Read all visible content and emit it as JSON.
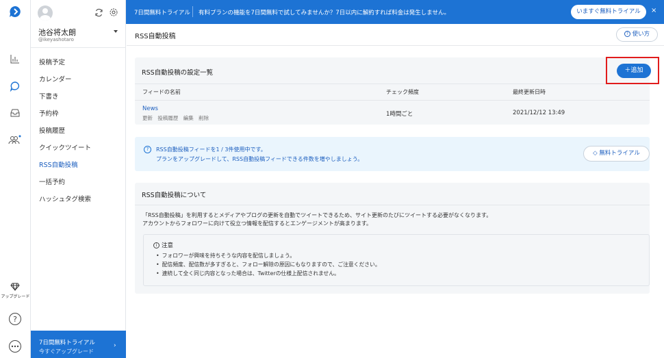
{
  "rail": {
    "upgrade_label": "アップグレード"
  },
  "sidebar": {
    "user_name": "池谷将太朗",
    "user_handle": "@ikeyashotaro",
    "items": [
      {
        "label": "投稿予定"
      },
      {
        "label": "カレンダー"
      },
      {
        "label": "下書き"
      },
      {
        "label": "予約枠"
      },
      {
        "label": "投稿履歴"
      },
      {
        "label": "クイックツイート"
      },
      {
        "label": "RSS自動投稿"
      },
      {
        "label": "一括予約"
      },
      {
        "label": "ハッシュタグ検索"
      }
    ],
    "active_index": 6,
    "trial_title": "7日間無料トライアル",
    "trial_sub": "今すぐアップグレード",
    "trial_arrow": "›"
  },
  "banner": {
    "title": "7日間無料トライアル",
    "text": "有料プランの機能を7日間無料で試してみませんか？7日以内に解約すれば料金は発生しません。",
    "button": "いますぐ無料トライアル",
    "close": "×"
  },
  "main": {
    "page_title": "RSS自動投稿",
    "help_label": "使い方",
    "settings_card": {
      "title": "RSS自動投稿の設定一覧",
      "add_label": "＋追加",
      "columns": [
        "フィードの名前",
        "チェック頻度",
        "最終更新日時"
      ],
      "rows": [
        {
          "name": "News",
          "actions": [
            "更新",
            "投稿履歴",
            "編集",
            "削除"
          ],
          "frequency": "1時間ごと",
          "updated": "2021/12/12 13:49"
        }
      ]
    },
    "info_card": {
      "line1": "RSS自動投稿フィードを1 / 3件使用中です。",
      "line2": "プランをアップグレードして、RSS自動投稿フィードできる件数を増やしましょう。",
      "trial_label": "無料トライアル"
    },
    "about_card": {
      "title": "RSS自動投稿について",
      "desc1": "「RSS自動投稿」を利用するとメディアやブログの更新を自動でツイートできるため、サイト更新のたびにツイートする必要がなくなります。",
      "desc2": "アカウントからフォロワーに向けて役立つ情報を配信するとエンゲージメントが高まります。",
      "note_title": "注意",
      "notes": [
        "フォロワーが興味を持ちそうな内容を配信しましょう。",
        "配信頻度、配信数が多すぎると、フォロー解除の原因にもなりますので、ご注意ください。",
        "連続して全く同じ内容となった場合は、Twitterの仕様上配信されません。"
      ]
    }
  },
  "colors": {
    "brand": "#1d73d4",
    "highlight": "#e11c1c"
  }
}
